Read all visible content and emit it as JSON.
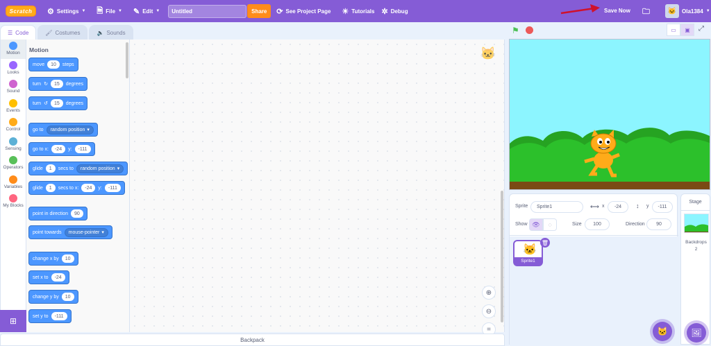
{
  "menubar": {
    "logo": "Scratch",
    "settings": "Settings",
    "file": "File",
    "edit": "Edit",
    "project_title": "Untitled",
    "share": "Share",
    "see_project_page": "See Project Page",
    "tutorials": "Tutorials",
    "debug": "Debug",
    "save_now": "Save Now",
    "username": "Ola1384"
  },
  "tabs": {
    "code": "Code",
    "costumes": "Costumes",
    "sounds": "Sounds"
  },
  "categories": [
    {
      "label": "Motion",
      "color": "#4c97ff"
    },
    {
      "label": "Looks",
      "color": "#9966ff"
    },
    {
      "label": "Sound",
      "color": "#cf63cf"
    },
    {
      "label": "Events",
      "color": "#ffbf00"
    },
    {
      "label": "Control",
      "color": "#ffab19"
    },
    {
      "label": "Sensing",
      "color": "#5cb1d6"
    },
    {
      "label": "Operators",
      "color": "#59c059"
    },
    {
      "label": "Variables",
      "color": "#ff8c1a"
    },
    {
      "label": "My Blocks",
      "color": "#ff6680"
    }
  ],
  "palette": {
    "title": "Motion",
    "move": {
      "a": "move",
      "n": "10",
      "b": "steps"
    },
    "turn_right": {
      "a": "turn",
      "n": "15",
      "b": "degrees"
    },
    "turn_left": {
      "a": "turn",
      "n": "15",
      "b": "degrees"
    },
    "goto": {
      "a": "go to",
      "d": "random position"
    },
    "goto_xy": {
      "a": "go to x:",
      "x": "-24",
      "b": "y:",
      "y": "-111"
    },
    "glide_to": {
      "a": "glide",
      "n": "1",
      "b": "secs to",
      "d": "random position"
    },
    "glide_xy": {
      "a": "glide",
      "n": "1",
      "b": "secs to x:",
      "x": "-24",
      "c": "y:",
      "y": "-111"
    },
    "point_dir": {
      "a": "point in direction",
      "n": "90"
    },
    "point_towards": {
      "a": "point towards",
      "d": "mouse-pointer"
    },
    "change_x": {
      "a": "change x by",
      "n": "10"
    },
    "set_x": {
      "a": "set x to",
      "n": "-24"
    },
    "change_y": {
      "a": "change y by",
      "n": "10"
    },
    "set_y": {
      "a": "set y to",
      "n": "-111"
    }
  },
  "backpack": "Backpack",
  "sprite_info": {
    "sprite_label": "Sprite",
    "sprite_name": "Sprite1",
    "x_label": "x",
    "x": "-24",
    "y_label": "y",
    "y": "-111",
    "show_label": "Show",
    "size_label": "Size",
    "size": "100",
    "direction_label": "Direction",
    "direction": "90"
  },
  "sprites": [
    {
      "name": "Sprite1"
    }
  ],
  "stage_panel": {
    "title": "Stage",
    "backdrops_label": "Backdrops",
    "backdrops_count": "2"
  }
}
